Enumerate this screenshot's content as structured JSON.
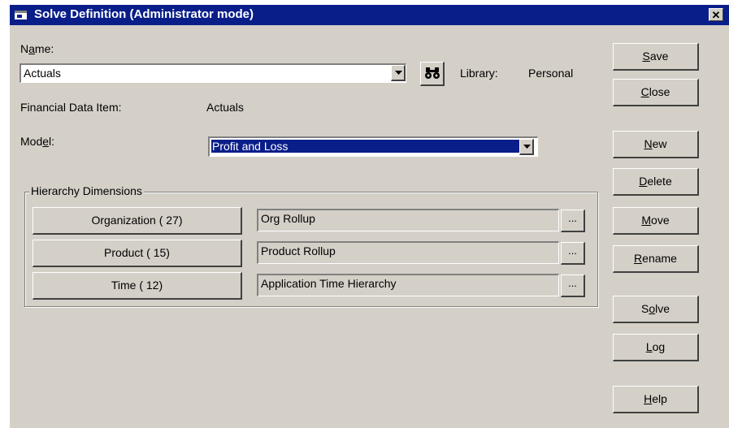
{
  "window": {
    "title": "Solve Definition (Administrator mode)",
    "close_glyph": "✕"
  },
  "name_field": {
    "label_pre": "N",
    "label_underlined": "a",
    "label_post": "me:",
    "value": "Actuals"
  },
  "library": {
    "label": "Library:",
    "value": "Personal"
  },
  "financial_data_item": {
    "label": "Financial Data Item:",
    "value": "Actuals"
  },
  "model": {
    "label_pre": "Mod",
    "label_underlined": "e",
    "label_post": "l:",
    "value": "Profit and Loss"
  },
  "hierarchy": {
    "group_label": "Hierarchy Dimensions",
    "rows": [
      {
        "dimension": "Organization ( 27)",
        "hierarchy": "Org Rollup",
        "browse": "..."
      },
      {
        "dimension": "Product ( 15)",
        "hierarchy": "Product Rollup",
        "browse": "..."
      },
      {
        "dimension": "Time ( 12)",
        "hierarchy": "Application Time Hierarchy",
        "browse": "..."
      }
    ]
  },
  "buttons": {
    "save": {
      "u": "S",
      "rest": "ave"
    },
    "close": {
      "u": "C",
      "rest": "lose"
    },
    "new": {
      "u": "N",
      "rest": "ew"
    },
    "delete": {
      "u": "D",
      "rest": "elete"
    },
    "move": {
      "u": "M",
      "rest": "ove"
    },
    "rename": {
      "u": "R",
      "rest": "ename"
    },
    "solve": {
      "pre": "S",
      "u": "o",
      "rest": "lve"
    },
    "log": {
      "u": "L",
      "rest": "og"
    },
    "help": {
      "u": "H",
      "rest": "elp"
    }
  },
  "icons": {
    "app": "window-app-icon",
    "find": "binoculars-icon",
    "dropdown": "chevron-down-icon"
  }
}
